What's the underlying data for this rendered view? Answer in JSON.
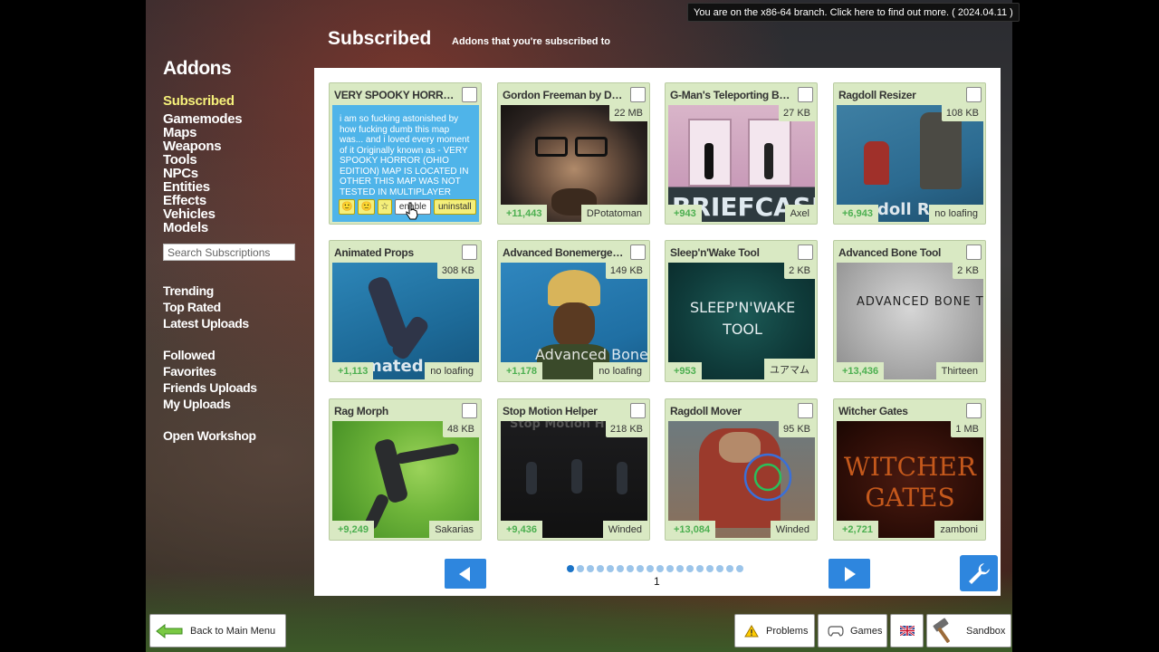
{
  "branch_notice": "You are on the x86-64 branch. Click here to find out more. ( 2024.04.11 )",
  "header": {
    "title": "Subscribed",
    "subtitle": "Addons that you're subscribed to"
  },
  "sidebar": {
    "heading": "Addons",
    "categories": [
      "Subscribed",
      "Gamemodes",
      "Maps",
      "Weapons",
      "Tools",
      "NPCs",
      "Entities",
      "Effects",
      "Vehicles",
      "Models"
    ],
    "search_placeholder": "Search Subscriptions",
    "browse_links": [
      "Trending",
      "Top Rated",
      "Latest Uploads"
    ],
    "personal_links": [
      "Followed",
      "Favorites",
      "Friends Uploads",
      "My Uploads"
    ],
    "workshop_link": "Open Workshop"
  },
  "addons": [
    {
      "title": "VERY SPOOKY HORROR (OHIO EDITION)",
      "description": "i am so fucking astonished by how fucking dumb this map was... and i loved every moment of it Originally known as - VERY SPOOKY HORROR (OHIO EDITION) MAP IS LOCATED IN OTHER THIS MAP WAS NOT TESTED IN MULTIPLAYER",
      "actions": {
        "like": "🙂",
        "dislike": "🙁",
        "favorite": "☆",
        "enable": "enable",
        "uninstall": "uninstall"
      }
    },
    {
      "title": "Gordon Freeman by DPotatoman",
      "size": "22 MB",
      "votes": "+11,443",
      "author": "DPotatoman"
    },
    {
      "title": "G-Man's Teleporting Briefcase",
      "size": "27 KB",
      "votes": "+943",
      "author": "Axel",
      "overlay": "BRIEFCASE"
    },
    {
      "title": "Ragdoll Resizer",
      "size": "108 KB",
      "votes": "+6,943",
      "author": "no loafing",
      "overlay": "agdoll Re"
    },
    {
      "title": "Animated Props",
      "size": "308 KB",
      "votes": "+1,113",
      "author": "no loafing",
      "overlay": "mated"
    },
    {
      "title": "Advanced Bonemerge Tool",
      "size": "149 KB",
      "votes": "+1,178",
      "author": "no loafing",
      "overlay": "Advanced Bonemerge"
    },
    {
      "title": "Sleep'n'Wake Tool",
      "size": "2 KB",
      "votes": "+953",
      "author": "ユアマム",
      "overlay": "SLEEP'N'WAKE TOOL"
    },
    {
      "title": "Advanced Bone Tool",
      "size": "2 KB",
      "votes": "+13,436",
      "author": "Thirteen",
      "overlay": "ADVANCED BONE TOOL"
    },
    {
      "title": "Rag Morph",
      "size": "48 KB",
      "votes": "+9,249",
      "author": "Sakarias"
    },
    {
      "title": "Stop Motion Helper",
      "size": "218 KB",
      "votes": "+9,436",
      "author": "Winded",
      "overlay": "Stop Motion H"
    },
    {
      "title": "Ragdoll Mover",
      "size": "95 KB",
      "votes": "+13,084",
      "author": "Winded"
    },
    {
      "title": "Witcher Gates",
      "size": "1 MB",
      "votes": "+2,721",
      "author": "zamboni",
      "overlay": "WITCHER GATES"
    }
  ],
  "pagination": {
    "current_page": "1",
    "total_pages": 18,
    "active_index": 0
  },
  "bottom_bar": {
    "back_label": "Back to Main Menu",
    "problems_label": "Problems",
    "games_label": "Games",
    "sandbox_label": "Sandbox"
  },
  "colors": {
    "card_bg": "#d9e9c3",
    "accent_blue": "#2e86de",
    "active_category": "#f5f07a",
    "vote_green": "#4caf50"
  }
}
